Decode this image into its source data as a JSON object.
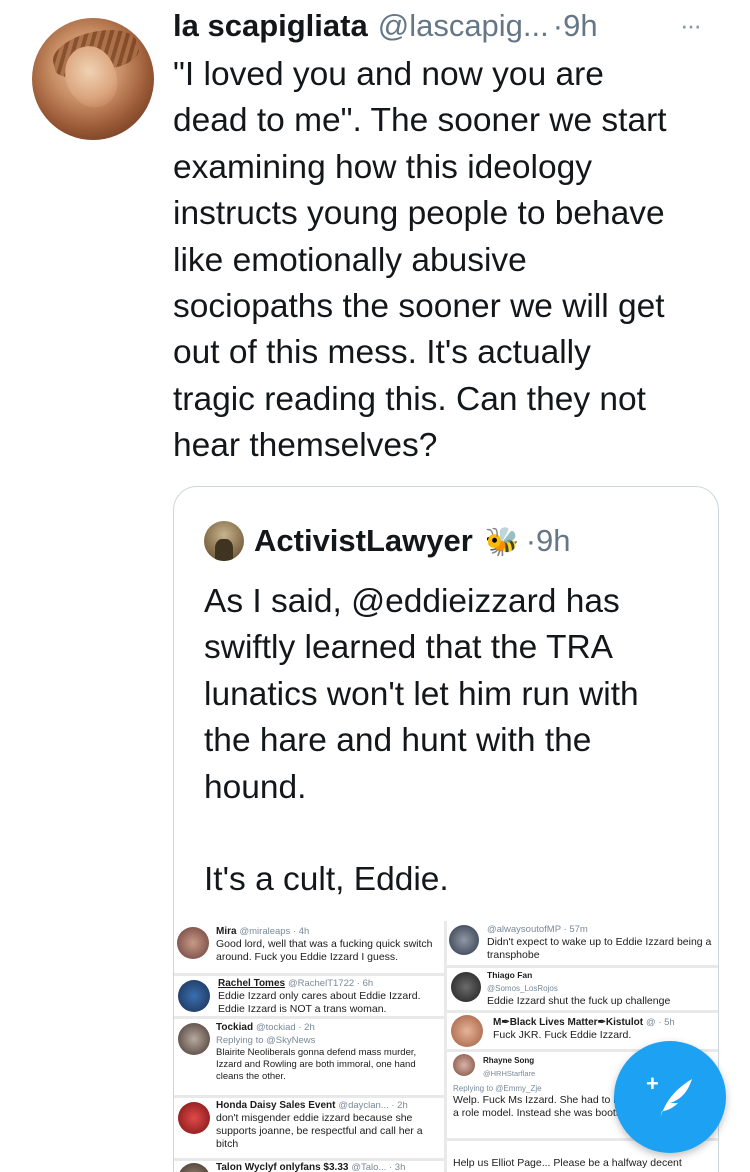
{
  "tweet": {
    "display_name": "la scapigliata",
    "handle": "@lascapig...",
    "time": "·9h",
    "more_glyph": "···",
    "text_lines": [
      "\"I loved you and now you are",
      "dead to me\". The sooner we start",
      "examining how this ideology",
      "instructs young people to behave",
      "like emotionally abusive",
      "sociopaths the sooner we will get",
      "out of this mess. It's actually",
      "tragic reading this. Can they not",
      "hear themselves?"
    ]
  },
  "quote": {
    "display_name": "ActivistLawyer",
    "emoji": "🐝",
    "time": "·9h",
    "text_lines": [
      "As I said, @eddieizzard has",
      "swiftly learned that the TRA",
      "lunatics won't let him run with",
      "the hare and hunt with the",
      "hound.",
      "",
      "It's a cult, Eddie."
    ],
    "collage": {
      "mira": {
        "name": "Mira",
        "handle": "@miraleaps · 4h",
        "text": "Good lord, well that was a fucking quick switch around. Fuck you Eddie Izzard I guess."
      },
      "always": {
        "handle": "@alwaysoutofMP · 57m",
        "text": "Didn't expect to wake up to Eddie Izzard being a transphobe"
      },
      "rachel": {
        "name": "Rachel Tomes",
        "handle": "@RachelT1722 · 6h",
        "text1": "Eddie Izzard only cares about Eddie Izzard.",
        "text2": "Eddie Izzard is NOT a trans woman."
      },
      "thiago": {
        "name": "Thiago Fan",
        "handle": "@Somos_LosRojos",
        "text": "Eddie Izzard shut the fuck up challenge"
      },
      "tockiad": {
        "name": "Tockiad",
        "handle": "@tockiad · 2h",
        "reply": "Replying to @SkyNews",
        "text": "Blairite Neoliberals gonna defend mass murder, Izzard and Rowling are both immoral, one hand cleans the other."
      },
      "blm": {
        "name": "M✒Black Lives Matter✒Kistulot",
        "handle": "@ · 5h",
        "text": "Fuck JKR. Fuck Eddie Izzard."
      },
      "rhayne": {
        "name": "Rhayne Song",
        "handle": "@HRHStarflare",
        "reply": "Replying to @Emmy_Zje",
        "text": "Welp.  Fuck Ms Izzard.  She had to be a role model.  Instead she was boots."
      },
      "honda": {
        "name": "Honda Daisy Sales Event",
        "handle": "@dayclan... · 2h",
        "text": "don't misgender eddie izzard because she supports joanne, be respectful and call her a bitch"
      },
      "talon": {
        "name": "Talon Wyclyf onlyfans $3.33",
        "handle": "@Talo... · 3h"
      },
      "elliot": {
        "text": "Help us Elliot Page... Please be a halfway decent"
      }
    }
  },
  "compose_button": {
    "label": "+"
  },
  "colors": {
    "accent": "#1da1f2",
    "secondary_text": "#657786",
    "border": "#ccd6dd"
  }
}
